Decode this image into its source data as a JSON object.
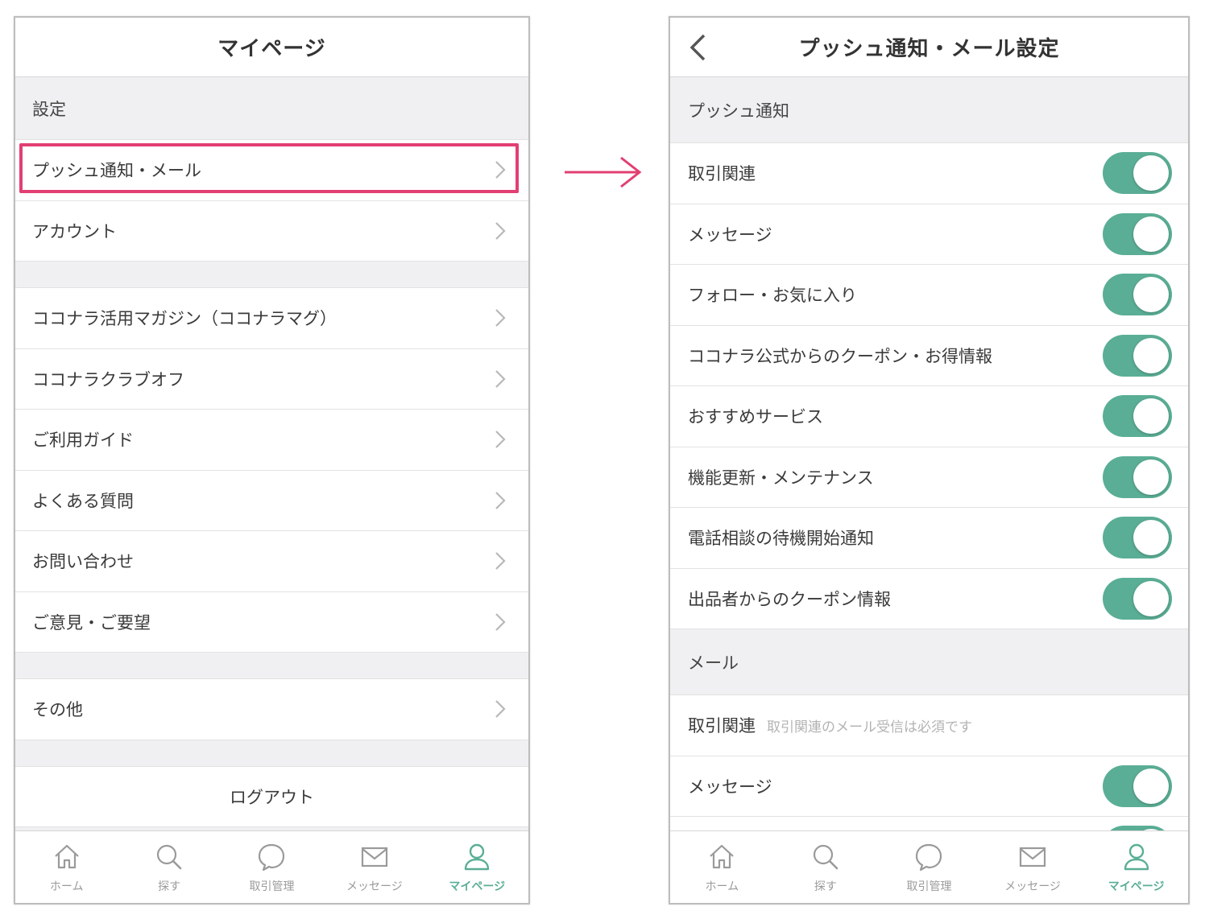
{
  "left": {
    "title": "マイページ",
    "settings_section": "設定",
    "group1": [
      {
        "label": "プッシュ通知・メール"
      },
      {
        "label": "アカウント"
      }
    ],
    "group2": [
      {
        "label": "ココナラ活用マガジン（ココナラマグ）"
      },
      {
        "label": "ココナラクラブオフ"
      },
      {
        "label": "ご利用ガイド"
      },
      {
        "label": "よくある質問"
      },
      {
        "label": "お問い合わせ"
      },
      {
        "label": "ご意見・ご要望"
      }
    ],
    "group3": [
      {
        "label": "その他"
      }
    ],
    "logout": "ログアウト"
  },
  "right": {
    "title": "プッシュ通知・メール設定",
    "push_section": "プッシュ通知",
    "push_items": [
      {
        "label": "取引関連",
        "on": true
      },
      {
        "label": "メッセージ",
        "on": true
      },
      {
        "label": "フォロー・お気に入り",
        "on": true
      },
      {
        "label": "ココナラ公式からのクーポン・お得情報",
        "on": true
      },
      {
        "label": "おすすめサービス",
        "on": true
      },
      {
        "label": "機能更新・メンテナンス",
        "on": true
      },
      {
        "label": "電話相談の待機開始通知",
        "on": true
      },
      {
        "label": "出品者からのクーポン情報",
        "on": true
      }
    ],
    "mail_section": "メール",
    "mail_items": [
      {
        "label": "取引関連",
        "note": "取引関連のメール受信は必須です"
      },
      {
        "label": "メッセージ",
        "on": true
      }
    ]
  },
  "tabs": [
    {
      "label": "ホーム",
      "icon": "home-icon"
    },
    {
      "label": "探す",
      "icon": "search-icon"
    },
    {
      "label": "取引管理",
      "icon": "chat-bubble-icon"
    },
    {
      "label": "メッセージ",
      "icon": "mail-icon"
    },
    {
      "label": "マイページ",
      "icon": "user-icon",
      "active": true
    }
  ],
  "colors": {
    "accent": "#5aae95",
    "highlight": "#e23f72",
    "background": "#f0f0f2"
  }
}
